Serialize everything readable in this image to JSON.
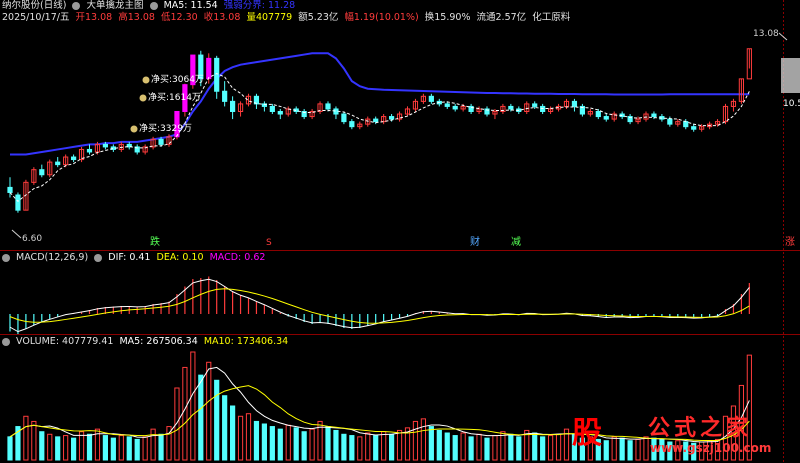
{
  "header": {
    "stock_name": "纳尔股份(日线)",
    "indicator_name": "大单擒龙主图",
    "ma5_label": "MA5: 11.54",
    "ma_line_label": "强弱分界: 11.28"
  },
  "quote": {
    "date": "2025/10/17/五",
    "open": "开13.08",
    "high": "高13.08",
    "low": "低12.30",
    "close": "收13.08",
    "volume": "量407779",
    "amount": "额5.23亿",
    "change": "幅1.19(10.01%)",
    "turnover": "换15.90%",
    "float": "流通2.57亿",
    "industry": "化工原料"
  },
  "price_panel": {
    "high_label": "13.08",
    "low_label": "6.60",
    "right_label": "10.5",
    "annotations": [
      "净买:3064万",
      "净买:1614万",
      "净买:3329万"
    ],
    "markers": [
      "跌",
      "S",
      "财",
      "减",
      "涨"
    ]
  },
  "macd": {
    "title": "MACD(12,26,9)",
    "dif": "DIF: 0.41",
    "dea": "DEA: 0.10",
    "macd": "MACD: 0.62"
  },
  "volume_panel": {
    "title": "VOLUME: 407779.41",
    "ma5": "MA5: 267506.34",
    "ma10": "MA10: 173406.34"
  },
  "watermark": {
    "glyph": "股",
    "name": "公式之家",
    "url": "www.gszj100.com"
  },
  "colors": {
    "up": "#ff3c3c",
    "down": "#54ffff",
    "ma_blue": "#3434ff",
    "dash": "#ffffff",
    "magenta": "#ff00ff",
    "dif": "#ffffff",
    "dea": "#ffff00",
    "macd_label": "#ff00ff"
  },
  "chart_data": {
    "type": "candlestick",
    "price_range": [
      6.6,
      13.08
    ],
    "candles": [
      [
        7.6,
        7.4,
        8.0,
        7.2
      ],
      [
        7.3,
        6.7,
        7.4,
        6.6
      ],
      [
        6.7,
        7.8,
        7.9,
        6.7
      ],
      [
        7.8,
        8.3,
        8.4,
        7.7
      ],
      [
        8.3,
        8.1,
        8.5,
        8.0
      ],
      [
        8.1,
        8.6,
        8.7,
        8.0
      ],
      [
        8.6,
        8.5,
        8.8,
        8.4
      ],
      [
        8.5,
        8.8,
        8.9,
        8.4
      ],
      [
        8.8,
        8.7,
        8.9,
        8.6
      ],
      [
        8.7,
        9.1,
        9.2,
        8.6
      ],
      [
        9.1,
        9.0,
        9.3,
        8.9
      ],
      [
        9.0,
        9.3,
        9.4,
        8.9
      ],
      [
        9.3,
        9.2,
        9.4,
        9.1
      ],
      [
        9.2,
        9.1,
        9.3,
        9.0
      ],
      [
        9.1,
        9.3,
        9.4,
        9.0
      ],
      [
        9.3,
        9.2,
        9.4,
        9.1
      ],
      [
        9.2,
        9.0,
        9.3,
        8.9
      ],
      [
        9.0,
        9.2,
        9.3,
        8.9
      ],
      [
        9.2,
        9.5,
        9.6,
        9.1
      ],
      [
        9.5,
        9.3,
        9.6,
        9.2
      ],
      [
        9.3,
        9.6,
        9.7,
        9.2
      ],
      [
        9.6,
        10.6,
        10.6,
        9.5
      ],
      [
        10.6,
        11.66,
        11.7,
        10.4
      ],
      [
        11.66,
        12.83,
        12.83,
        11.5
      ],
      [
        12.83,
        11.9,
        13.0,
        11.6
      ],
      [
        11.9,
        12.7,
        12.9,
        11.7
      ],
      [
        12.7,
        11.4,
        12.8,
        11.1
      ],
      [
        11.4,
        11.0,
        11.8,
        10.8
      ],
      [
        11.0,
        10.6,
        11.2,
        10.3
      ],
      [
        10.6,
        10.9,
        11.0,
        10.4
      ],
      [
        10.9,
        11.2,
        11.3,
        10.8
      ],
      [
        11.2,
        10.9,
        11.3,
        10.7
      ],
      [
        10.9,
        10.8,
        11.0,
        10.6
      ],
      [
        10.8,
        10.6,
        10.9,
        10.5
      ],
      [
        10.6,
        10.5,
        10.7,
        10.3
      ],
      [
        10.5,
        10.7,
        10.8,
        10.4
      ],
      [
        10.7,
        10.6,
        10.8,
        10.5
      ],
      [
        10.6,
        10.4,
        10.7,
        10.3
      ],
      [
        10.4,
        10.6,
        10.7,
        10.3
      ],
      [
        10.6,
        10.9,
        11.0,
        10.5
      ],
      [
        10.9,
        10.7,
        11.0,
        10.6
      ],
      [
        10.7,
        10.5,
        10.8,
        10.3
      ],
      [
        10.5,
        10.2,
        10.6,
        10.1
      ],
      [
        10.2,
        10.0,
        10.3,
        9.9
      ],
      [
        10.0,
        10.1,
        10.2,
        9.9
      ],
      [
        10.1,
        10.3,
        10.4,
        10.0
      ],
      [
        10.3,
        10.2,
        10.4,
        10.1
      ],
      [
        10.2,
        10.4,
        10.5,
        10.1
      ],
      [
        10.4,
        10.3,
        10.5,
        10.2
      ],
      [
        10.3,
        10.5,
        10.6,
        10.2
      ],
      [
        10.5,
        10.7,
        10.8,
        10.4
      ],
      [
        10.7,
        11.0,
        11.1,
        10.6
      ],
      [
        11.0,
        11.2,
        11.3,
        10.9
      ],
      [
        11.2,
        11.0,
        11.3,
        10.9
      ],
      [
        11.0,
        10.9,
        11.1,
        10.8
      ],
      [
        10.9,
        10.8,
        11.0,
        10.7
      ],
      [
        10.8,
        10.7,
        10.9,
        10.6
      ],
      [
        10.7,
        10.8,
        10.9,
        10.6
      ],
      [
        10.8,
        10.6,
        10.9,
        10.5
      ],
      [
        10.6,
        10.7,
        10.8,
        10.5
      ],
      [
        10.7,
        10.5,
        10.8,
        10.4
      ],
      [
        10.5,
        10.6,
        10.7,
        10.3
      ],
      [
        10.6,
        10.8,
        10.9,
        10.5
      ],
      [
        10.8,
        10.7,
        10.9,
        10.6
      ],
      [
        10.7,
        10.6,
        10.8,
        10.5
      ],
      [
        10.6,
        10.9,
        11.0,
        10.5
      ],
      [
        10.9,
        10.8,
        11.0,
        10.7
      ],
      [
        10.8,
        10.6,
        10.9,
        10.5
      ],
      [
        10.6,
        10.7,
        10.8,
        10.5
      ],
      [
        10.7,
        10.8,
        10.9,
        10.6
      ],
      [
        10.8,
        11.0,
        11.1,
        10.7
      ],
      [
        11.0,
        10.8,
        11.1,
        10.6
      ],
      [
        10.8,
        10.5,
        10.9,
        10.4
      ],
      [
        10.5,
        10.6,
        10.7,
        10.4
      ],
      [
        10.6,
        10.4,
        10.7,
        10.3
      ],
      [
        10.4,
        10.3,
        10.5,
        10.2
      ],
      [
        10.3,
        10.5,
        10.6,
        10.2
      ],
      [
        10.5,
        10.4,
        10.6,
        10.3
      ],
      [
        10.4,
        10.2,
        10.5,
        10.1
      ],
      [
        10.2,
        10.3,
        10.4,
        10.1
      ],
      [
        10.3,
        10.5,
        10.6,
        10.2
      ],
      [
        10.5,
        10.4,
        10.6,
        10.3
      ],
      [
        10.4,
        10.3,
        10.5,
        10.2
      ],
      [
        10.3,
        10.1,
        10.4,
        10.0
      ],
      [
        10.1,
        10.2,
        10.3,
        10.0
      ],
      [
        10.2,
        10.0,
        10.3,
        9.9
      ],
      [
        10.0,
        9.9,
        10.1,
        9.8
      ],
      [
        9.9,
        10.0,
        10.1,
        9.8
      ],
      [
        10.0,
        10.1,
        10.2,
        9.9
      ],
      [
        10.1,
        10.2,
        10.3,
        10.0
      ],
      [
        10.2,
        10.8,
        10.9,
        10.1
      ],
      [
        10.8,
        11.0,
        11.1,
        10.6
      ],
      [
        11.0,
        11.89,
        11.9,
        10.9
      ],
      [
        11.89,
        13.08,
        13.08,
        12.3
      ]
    ],
    "ma_line": [
      8.9,
      8.9,
      8.9,
      8.95,
      9.0,
      9.05,
      9.1,
      9.15,
      9.2,
      9.25,
      9.3,
      9.3,
      9.35,
      9.35,
      9.4,
      9.4,
      9.4,
      9.45,
      9.5,
      9.55,
      9.6,
      9.7,
      10.1,
      10.6,
      11.0,
      11.5,
      11.9,
      12.2,
      12.35,
      12.45,
      12.5,
      12.55,
      12.6,
      12.65,
      12.7,
      12.75,
      12.8,
      12.85,
      12.9,
      12.9,
      12.9,
      12.7,
      12.3,
      11.8,
      11.6,
      11.5,
      11.48,
      11.46,
      11.45,
      11.44,
      11.43,
      11.42,
      11.41,
      11.4,
      11.39,
      11.38,
      11.37,
      11.36,
      11.35,
      11.34,
      11.33,
      11.33,
      11.32,
      11.32,
      11.31,
      11.31,
      11.3,
      11.3,
      11.3,
      11.29,
      11.29,
      11.29,
      11.28,
      11.28,
      11.28,
      11.28,
      11.27,
      11.27,
      11.27,
      11.27,
      11.27,
      11.27,
      11.27,
      11.28,
      11.28,
      11.28,
      11.28,
      11.28,
      11.28,
      11.28,
      11.28,
      11.28,
      11.28,
      11.28
    ],
    "volume": [
      90,
      130,
      170,
      150,
      110,
      100,
      90,
      95,
      85,
      110,
      100,
      120,
      95,
      85,
      95,
      90,
      80,
      90,
      120,
      100,
      130,
      280,
      360,
      420,
      330,
      380,
      310,
      250,
      210,
      170,
      180,
      150,
      140,
      130,
      120,
      135,
      125,
      110,
      120,
      150,
      130,
      115,
      100,
      95,
      90,
      105,
      95,
      110,
      100,
      115,
      125,
      150,
      160,
      130,
      115,
      105,
      95,
      105,
      90,
      100,
      85,
      95,
      110,
      100,
      90,
      115,
      105,
      90,
      95,
      100,
      120,
      100,
      85,
      90,
      80,
      75,
      90,
      85,
      75,
      80,
      90,
      85,
      80,
      70,
      75,
      70,
      65,
      70,
      75,
      80,
      170,
      210,
      290,
      407.78
    ],
    "macd_hist": [
      -0.35,
      -0.4,
      -0.3,
      -0.22,
      -0.15,
      -0.1,
      -0.05,
      0.0,
      0.02,
      0.05,
      0.08,
      0.12,
      0.14,
      0.15,
      0.16,
      0.16,
      0.15,
      0.16,
      0.2,
      0.22,
      0.25,
      0.4,
      0.55,
      0.7,
      0.72,
      0.75,
      0.68,
      0.56,
      0.45,
      0.38,
      0.33,
      0.25,
      0.18,
      0.1,
      0.02,
      -0.05,
      -0.1,
      -0.16,
      -0.2,
      -0.18,
      -0.2,
      -0.24,
      -0.28,
      -0.3,
      -0.28,
      -0.24,
      -0.2,
      -0.15,
      -0.12,
      -0.08,
      -0.04,
      0.02,
      0.06,
      0.06,
      0.04,
      0.02,
      0.0,
      0.01,
      -0.02,
      -0.01,
      -0.03,
      -0.02,
      0.01,
      0.0,
      -0.02,
      0.02,
      0.01,
      -0.02,
      -0.01,
      0.0,
      0.02,
      0.0,
      -0.04,
      -0.04,
      -0.06,
      -0.08,
      -0.06,
      -0.06,
      -0.08,
      -0.07,
      -0.05,
      -0.05,
      -0.06,
      -0.08,
      -0.07,
      -0.08,
      -0.09,
      -0.08,
      -0.06,
      -0.04,
      0.1,
      0.2,
      0.4,
      0.62
    ]
  }
}
